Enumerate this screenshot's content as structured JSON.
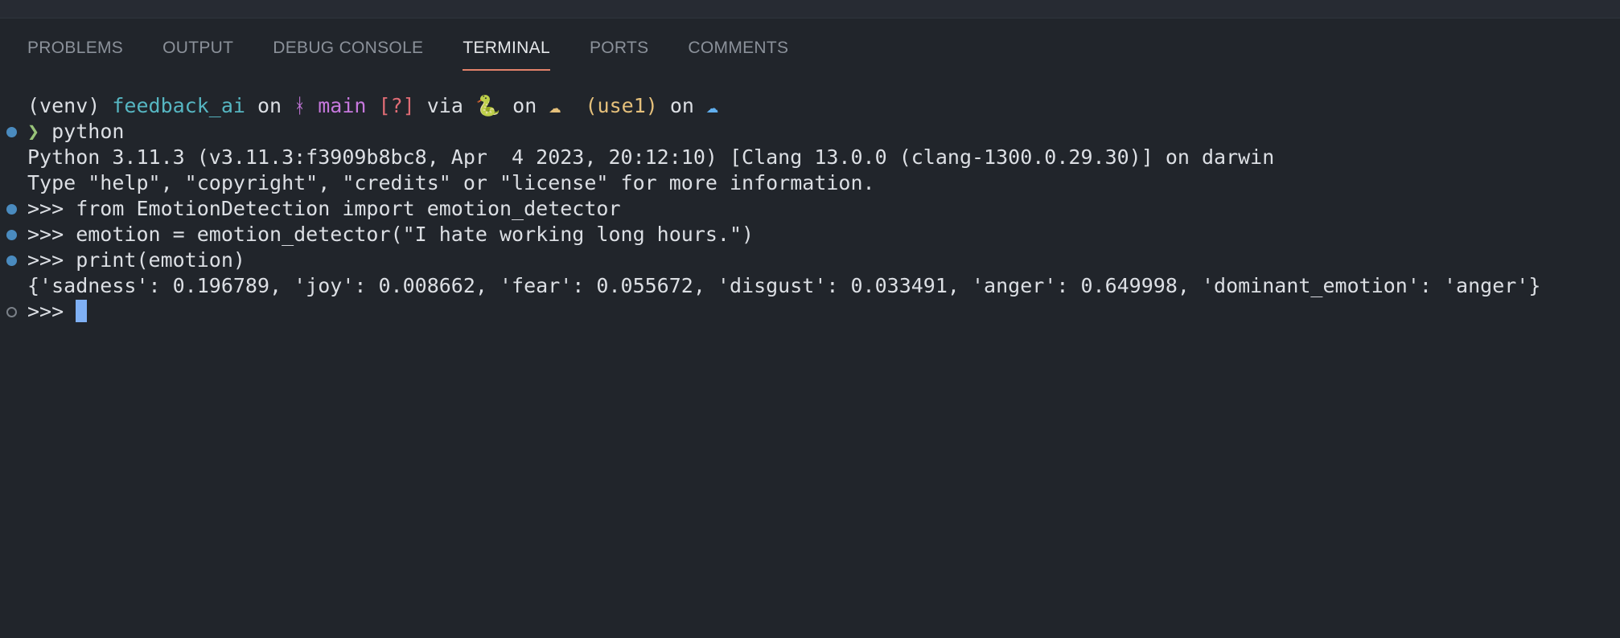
{
  "panel": {
    "tabs": [
      {
        "label": "PROBLEMS"
      },
      {
        "label": "OUTPUT"
      },
      {
        "label": "DEBUG CONSOLE"
      },
      {
        "label": "TERMINAL"
      },
      {
        "label": "PORTS"
      },
      {
        "label": "COMMENTS"
      }
    ],
    "active_tab": "TERMINAL"
  },
  "terminal": {
    "prompt": {
      "venv": "(venv)",
      "dir": "feedback_ai",
      "on1": " on ",
      "branch_icon": "ᚼ",
      "branch": "main",
      "status": "[?]",
      "via": " via ",
      "python_icon": "🐍",
      "on2": " on ",
      "aws_icon": "☁",
      "region": "(use1)",
      "on3": " on ",
      "cloud_icon": "☁",
      "chevron": "❯",
      "command": "python"
    },
    "lines": [
      "Python 3.11.3 (v3.11.3:f3909b8bc8, Apr  4 2023, 20:12:10) [Clang 13.0.0 (clang-1300.0.29.30)] on darwin",
      "Type \"help\", \"copyright\", \"credits\" or \"license\" for more information.",
      ">>> from EmotionDetection import emotion_detector",
      ">>> emotion = emotion_detector(\"I hate working long hours.\")",
      ">>> print(emotion)",
      "{'sadness': 0.196789, 'joy': 0.008662, 'fear': 0.055672, 'disgust': 0.033491, 'anger': 0.649998, 'dominant_emotion': 'anger'}"
    ],
    "repl_prompt": ">>> ",
    "colors": {
      "background": "#21252b",
      "text": "#dcdfe4",
      "dir": "#56b6c2",
      "branch": "#c678dd",
      "status": "#e06c75",
      "region": "#e5c07b",
      "active_tab_underline": "#e3826a",
      "cursor": "#7fb0f4"
    }
  }
}
